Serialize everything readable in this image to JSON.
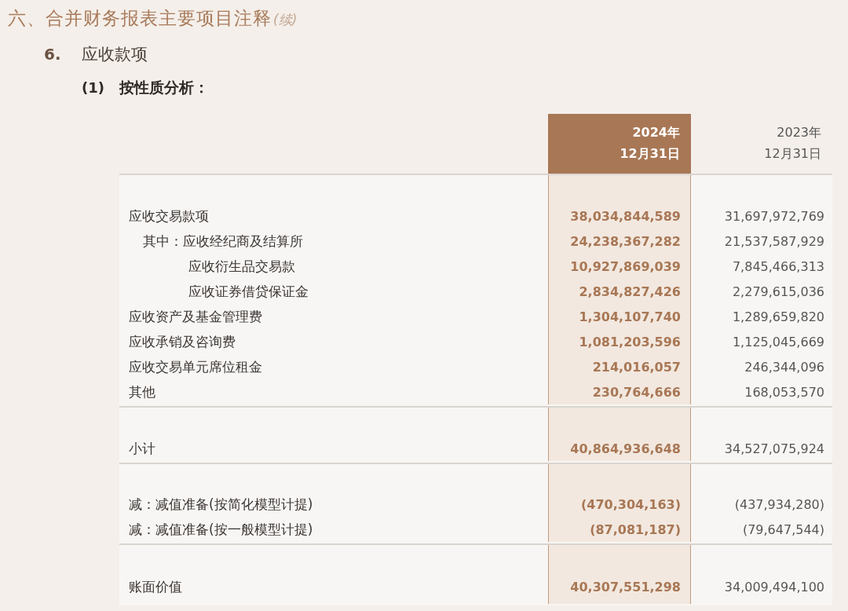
{
  "heading": {
    "title": "六、合并财务报表主要项目注释",
    "suffix": "(续)"
  },
  "section": {
    "number": "6.",
    "title": "应收款项"
  },
  "subsection": {
    "number": "(1)",
    "title": "按性质分析："
  },
  "table": {
    "columns": [
      {
        "line1": "2024年",
        "line2": "12月31日",
        "highlighted": true
      },
      {
        "line1": "2023年",
        "line2": "12月31日",
        "highlighted": false
      }
    ],
    "groups": [
      {
        "rows": [
          {
            "kind": "main",
            "label": "应收交易款项",
            "values": [
              "38,034,844,589",
              "31,697,972,769"
            ]
          },
          {
            "kind": "lead",
            "label": "其中：应收经纪商及结算所",
            "values": [
              "24,238,367,282",
              "21,537,587,929"
            ]
          },
          {
            "kind": "detail",
            "label": "应收衍生品交易款",
            "values": [
              "10,927,869,039",
              "7,845,466,313"
            ]
          },
          {
            "kind": "detail",
            "label": "应收证券借贷保证金",
            "values": [
              "2,834,827,426",
              "2,279,615,036"
            ]
          },
          {
            "kind": "main",
            "label": "应收资产及基金管理费",
            "values": [
              "1,304,107,740",
              "1,289,659,820"
            ]
          },
          {
            "kind": "main",
            "label": "应收承销及咨询费",
            "values": [
              "1,081,203,596",
              "1,125,045,669"
            ]
          },
          {
            "kind": "main",
            "label": "应收交易单元席位租金",
            "values": [
              "214,016,057",
              "246,344,096"
            ]
          },
          {
            "kind": "main",
            "label": "其他",
            "values": [
              "230,764,666",
              "168,053,570"
            ]
          }
        ]
      },
      {
        "rows": [
          {
            "kind": "main",
            "label": "小计",
            "values": [
              "40,864,936,648",
              "34,527,075,924"
            ]
          }
        ]
      },
      {
        "rows": [
          {
            "kind": "main",
            "label": "减：减值准备(按简化模型计提)",
            "values": [
              "(470,304,163)",
              "(437,934,280)"
            ]
          },
          {
            "kind": "main",
            "label": "减：减值准备(按一般模型计提)",
            "values": [
              "(87,081,187)",
              "(79,647,544)"
            ]
          }
        ]
      },
      {
        "rows": [
          {
            "kind": "main",
            "label": "账面价值",
            "values": [
              "40,307,551,298",
              "34,009,494,100"
            ]
          }
        ]
      }
    ]
  }
}
